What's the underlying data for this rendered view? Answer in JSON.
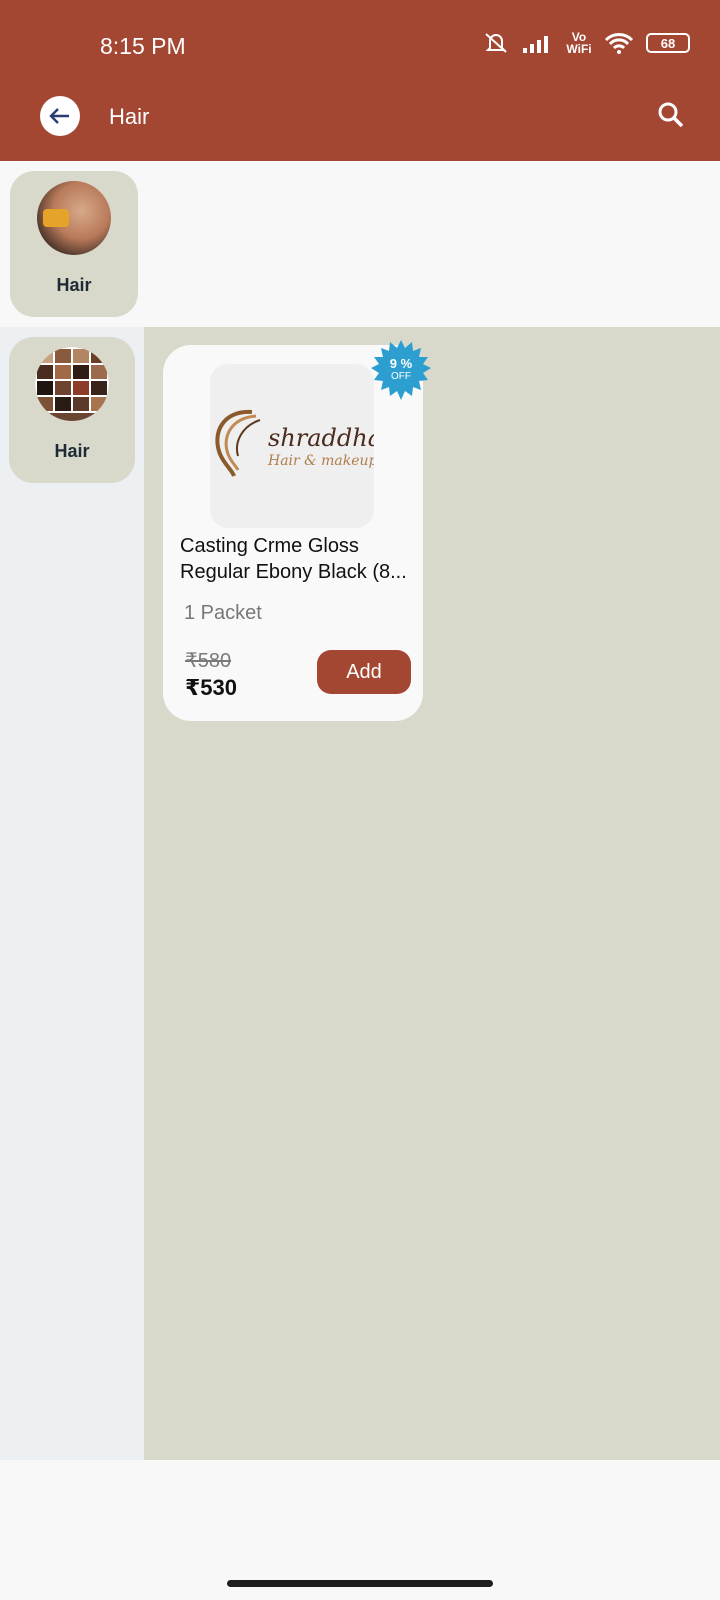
{
  "status_bar": {
    "time": "8:15 PM",
    "network": "Vo WiFi",
    "battery": "68"
  },
  "header": {
    "title": "Hair"
  },
  "top_categories": [
    {
      "label": "Hair"
    }
  ],
  "sidebar_categories": [
    {
      "label": "Hair"
    }
  ],
  "product": {
    "badge_percent": "9 %",
    "badge_off": "OFF",
    "brand_logo": "shraddha",
    "brand_sub": "Hair & makeup",
    "name": "Casting Crme Gloss Regular Ebony Black (8...",
    "unit": "1 Packet",
    "price_old": "₹580",
    "price_new": "₹530",
    "add_label": "Add"
  },
  "colors": {
    "brand": "#a34733",
    "content_bg": "#d9d9cb",
    "badge": "#2c9ed0"
  }
}
